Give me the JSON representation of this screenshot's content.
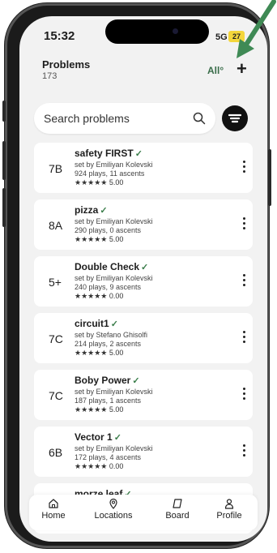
{
  "status": {
    "time": "15:32",
    "network": "5G",
    "battery": "27"
  },
  "header": {
    "title": "Problems",
    "count": "173",
    "filter": "All°",
    "add": "+"
  },
  "search": {
    "placeholder": "Search problems"
  },
  "problems": [
    {
      "grade": "7B",
      "name": "safety FIRST",
      "check": "✓",
      "setter": "set by Emiliyan Kolevski",
      "stats": "924 plays, 11 ascents",
      "stars": "★★★★★",
      "rating": "5.00"
    },
    {
      "grade": "8A",
      "name": "pizza",
      "check": "✓",
      "setter": "set by Emiliyan Kolevski",
      "stats": "290 plays, 0 ascents",
      "stars": "★★★★★",
      "rating": "5.00"
    },
    {
      "grade": "5+",
      "name": "Double Check",
      "check": "✓",
      "setter": "set by Emiliyan Kolevski",
      "stats": "240 plays, 9 ascents",
      "stars": "★★★★★",
      "rating": "0.00"
    },
    {
      "grade": "7C",
      "name": "circuit1",
      "check": "✓",
      "setter": "set by Stefano Ghisolfi",
      "stats": "214 plays, 2 ascents",
      "stars": "★★★★★",
      "rating": "5.00"
    },
    {
      "grade": "7C",
      "name": "Boby Power",
      "check": "✓",
      "setter": "set by Emiliyan Kolevski",
      "stats": "187 plays, 1 ascents",
      "stars": "★★★★★",
      "rating": "5.00"
    },
    {
      "grade": "6B",
      "name": "Vector 1",
      "check": "✓",
      "setter": "set by Emiliyan Kolevski",
      "stats": "172 plays, 4 ascents",
      "stars": "★★★★★",
      "rating": "0.00"
    },
    {
      "grade": "",
      "name": "morze leaf",
      "check": "✓",
      "setter": "",
      "stats": "",
      "stars": "",
      "rating": ""
    }
  ],
  "nav": [
    {
      "label": "Home",
      "icon": "home-icon"
    },
    {
      "label": "Locations",
      "icon": "location-pin-icon"
    },
    {
      "label": "Board",
      "icon": "board-icon"
    },
    {
      "label": "Profile",
      "icon": "profile-icon"
    }
  ],
  "colors": {
    "accent_green": "#3a7d4a",
    "arrow_green": "#3f8a55",
    "battery": "#f4d63b"
  }
}
